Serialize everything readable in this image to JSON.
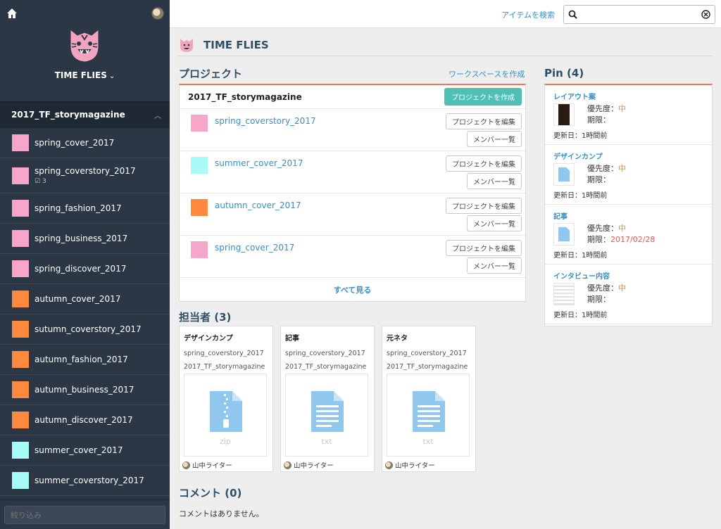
{
  "sidebar": {
    "workspace_name": "TIME FLIES",
    "section_title": "2017_TF_storymagazine",
    "items": [
      {
        "label": "spring_cover_2017",
        "color": "#f7a6c9"
      },
      {
        "label": "spring_coverstory_2017",
        "color": "#f7a6c9",
        "sub": "3"
      },
      {
        "label": "spring_fashion_2017",
        "color": "#f7a6c9"
      },
      {
        "label": "spring_business_2017",
        "color": "#f7a6c9"
      },
      {
        "label": "spring_discover_2017",
        "color": "#f7a6c9"
      },
      {
        "label": "autumn_cover_2017",
        "color": "#ff8a3d"
      },
      {
        "label": "sutumn_coverstory_2017",
        "color": "#ff8a3d"
      },
      {
        "label": "autumn_fashion_2017",
        "color": "#ff8a3d"
      },
      {
        "label": "autumn_business_2017",
        "color": "#ff8a3d"
      },
      {
        "label": "autumn_discover_2017",
        "color": "#ff8a3d"
      },
      {
        "label": "summer_cover_2017",
        "color": "#a8fbf6"
      },
      {
        "label": "summer_coverstory_2017",
        "color": "#a8fbf6"
      },
      {
        "label": "",
        "color": "#a8fbf6"
      }
    ],
    "filter_placeholder": "絞り込み"
  },
  "topbar": {
    "search_link": "アイテムを検索",
    "search_value": ""
  },
  "page": {
    "title": "TIME FLIES"
  },
  "projects": {
    "title": "プロジェクト",
    "create_workspace": "ワークスペースを作成",
    "workspace_name": "2017_TF_storymagazine",
    "create_project": "プロジェクトを作成",
    "edit_label": "プロジェクトを編集",
    "members_label": "メンバー一覧",
    "rows": [
      {
        "name": "spring_coverstory_2017",
        "color": "#f7a6c9"
      },
      {
        "name": "summer_cover_2017",
        "color": "#a8fbf6"
      },
      {
        "name": "autumn_cover_2017",
        "color": "#ff8a3d"
      },
      {
        "name": "spring_cover_2017",
        "color": "#f7a6c9"
      }
    ],
    "see_all": "すべて見る"
  },
  "assignees": {
    "title": "担当者 (3)",
    "cards": [
      {
        "title": "デザインカンプ",
        "project": "spring_coverstory_2017",
        "workspace": "2017_TF_storymagazine",
        "ext": "zip",
        "owner": "山中ライター"
      },
      {
        "title": "記事",
        "project": "spring_coverstory_2017",
        "workspace": "2017_TF_storymagazine",
        "ext": "txt",
        "owner": "山中ライター"
      },
      {
        "title": "元ネタ",
        "project": "spring_coverstory_2017",
        "workspace": "2017_TF_storymagazine",
        "ext": "txt",
        "owner": "山中ライター"
      }
    ]
  },
  "comments": {
    "title": "コメント (0)",
    "empty": "コメントはありません。"
  },
  "pins": {
    "title": "Pin (4)",
    "items": [
      {
        "title": "レイアウト案",
        "priority_label": "優先度：",
        "priority": "中",
        "due_label": "期限：",
        "due": "",
        "updated": "更新日：1時間前"
      },
      {
        "title": "デザインカンプ",
        "priority_label": "優先度：",
        "priority": "中",
        "due_label": "期限：",
        "due": "",
        "updated": "更新日：1時間前"
      },
      {
        "title": "記事",
        "priority_label": "優先度：",
        "priority": "中",
        "due_label": "期限：",
        "due": "2017/02/28",
        "updated": "更新日：1時間前"
      },
      {
        "title": "インタビュー内容",
        "priority_label": "優先度：",
        "priority": "中",
        "due_label": "期限：",
        "due": "",
        "updated": "更新日：1時間前"
      }
    ]
  }
}
